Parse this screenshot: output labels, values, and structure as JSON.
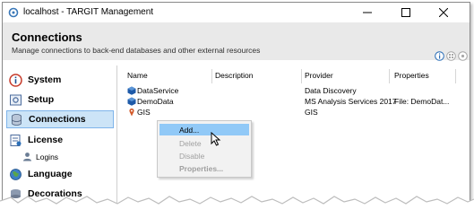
{
  "window": {
    "title": "localhost - TARGIT Management"
  },
  "header": {
    "title": "Connections",
    "subtitle": "Manage connections to back-end databases and other external resources"
  },
  "sidebar": {
    "items": [
      {
        "label": "System",
        "icon": "info-icon"
      },
      {
        "label": "Setup",
        "icon": "setup-icon"
      },
      {
        "label": "Connections",
        "icon": "database-icon",
        "selected": true
      },
      {
        "label": "License",
        "icon": "license-icon"
      },
      {
        "label": "Logins",
        "icon": "user-icon",
        "sub": true
      },
      {
        "label": "Language",
        "icon": "globe-icon"
      },
      {
        "label": "Decorations",
        "icon": "decorations-icon"
      }
    ]
  },
  "table": {
    "columns": [
      "Name",
      "Description",
      "Provider",
      "Properties"
    ],
    "rows": [
      {
        "name": "DataService",
        "description": "",
        "provider": "Data Discovery",
        "properties": "",
        "icon": "cube-icon"
      },
      {
        "name": "DemoData",
        "description": "",
        "provider": "MS Analysis Services 2017",
        "properties": "File: DemoDat...",
        "icon": "cube-icon"
      },
      {
        "name": "GIS",
        "description": "",
        "provider": "GIS",
        "properties": "",
        "icon": "gis-icon"
      }
    ]
  },
  "context_menu": {
    "items": [
      {
        "label": "Add...",
        "state": "highlighted"
      },
      {
        "label": "Delete",
        "state": "disabled"
      },
      {
        "label": "Disable",
        "state": "disabled"
      },
      {
        "label": "Properties...",
        "state": "disabled-bold"
      }
    ]
  },
  "colors": {
    "selection": "#cce4f7",
    "menu_highlight": "#91c9f7",
    "header_bg": "#e9e9e9"
  }
}
